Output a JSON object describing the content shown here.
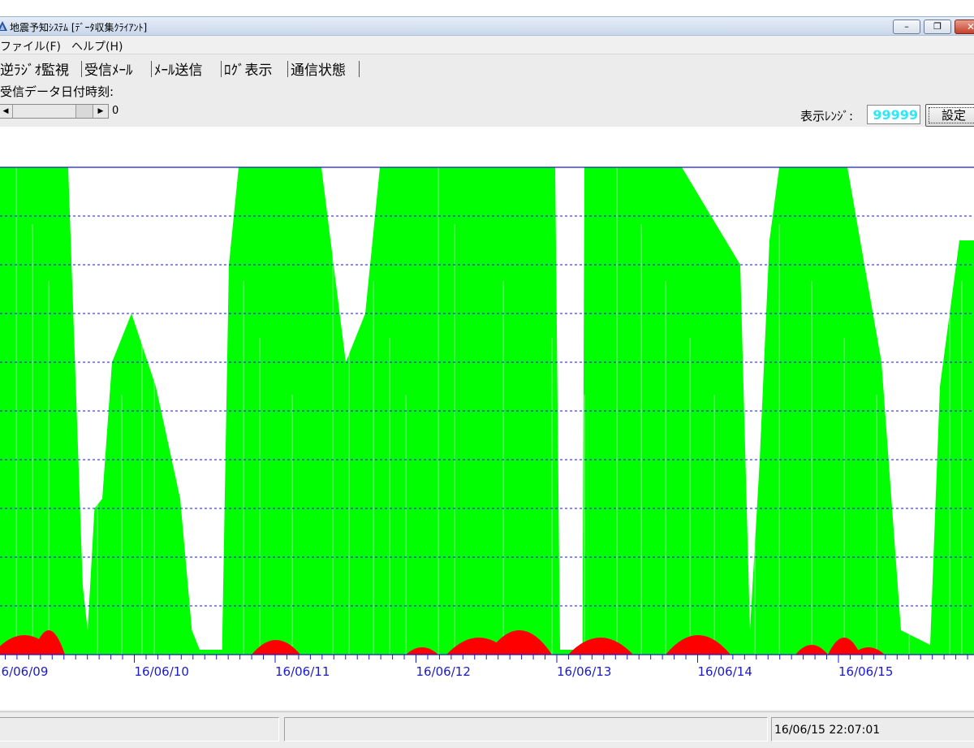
{
  "window": {
    "title": "地震予知ｼｽﾃﾑ [ﾃﾞｰﾀ収集ｸﾗｲｱﾝﾄ]",
    "controls": {
      "minimize": "–",
      "maximize": "❐",
      "close": "✕"
    }
  },
  "menu": [
    {
      "label": "ファイル(F)"
    },
    {
      "label": "ヘルプ(H)"
    }
  ],
  "tabs": [
    {
      "label": "逆ﾗｼﾞｵ監視",
      "active": true
    },
    {
      "label": "受信ﾒｰﾙ"
    },
    {
      "label": "ﾒｰﾙ送信"
    },
    {
      "label": "ﾛｸﾞ表示"
    },
    {
      "label": "通信状態"
    }
  ],
  "controls": {
    "date_label": "受信データ日付時刻:",
    "scroll_value": "0",
    "range_label": "表示ﾚﾝｼﾞ:",
    "range_value": "99999",
    "set_button": "設定"
  },
  "chart_data": {
    "type": "area",
    "x_ticks": [
      "16/06/09",
      "16/06/10",
      "16/06/11",
      "16/06/12",
      "16/06/13",
      "16/06/14",
      "16/06/15"
    ],
    "ylim": [
      0,
      99999
    ],
    "grid": true,
    "colors": {
      "primary_series": "#00ff00",
      "secondary_series": "#ff0000",
      "grid": "#1a1acc",
      "axis_labels": "#1a1acc"
    },
    "series": [
      {
        "color": "#00ff00",
        "values_approx_by_day_fraction": [
          [
            0.0,
            99999
          ],
          [
            0.3,
            99999
          ],
          [
            0.5,
            20000
          ],
          [
            0.6,
            40000
          ],
          [
            0.75,
            70000
          ],
          [
            0.95,
            8000
          ],
          [
            1.0,
            1000
          ]
        ]
      },
      {
        "color": "#ff0000",
        "values_approx_peaks": [
          8000,
          6000,
          7000,
          11000,
          9000,
          8000,
          7000,
          4000
        ]
      }
    ]
  },
  "status": {
    "timestamp": "16/06/15 22:07:01"
  }
}
